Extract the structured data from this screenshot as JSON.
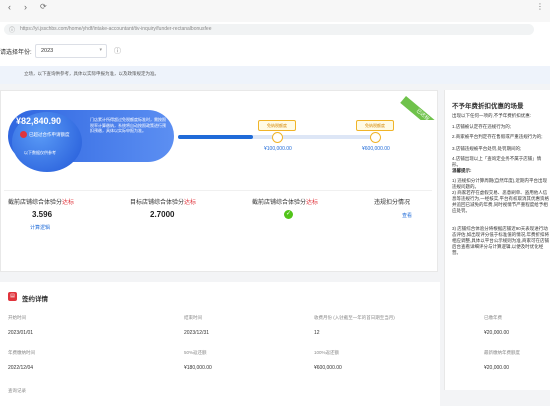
{
  "browser": {
    "url": "https://yi.jsschbs.com/home/yhdf/intake-accountant/tiv-inquiry/funder-rectanalbonusfee"
  },
  "filter": {
    "year_label": "请选择年份:",
    "year_value": "2023"
  },
  "notice": {
    "text": "立场，以下查询供参考，具体以实际申报为准，以及政策规定为准。"
  },
  "summary": {
    "amount": "¥82,840.90",
    "amount_sub": "已超过合作申请额度",
    "bubble_text": "已超过合作条件",
    "desc": "门店累计所得超过免税额度标准时，需按照税率计算缴纳，系统将自动按照政策进行预扣预缴，具体以实际申报为准。",
    "small_note": "以下数据仅供参考",
    "threshold_1": "¥100,000.00",
    "threshold_2": "¥600,000.00",
    "chip_1": "免纳税额度",
    "chip_2": "免纳税额度",
    "ribbon": "已达标"
  },
  "metrics": [
    {
      "title_a": "截前店铺综合体验分",
      "title_b": "达标",
      "value": "3.596",
      "link": "计算逻辑"
    },
    {
      "title_a": "目标店铺综合体验分",
      "title_b": "达标",
      "value": "2.7000",
      "link": ""
    },
    {
      "title_a": "截前店铺综合体验分",
      "title_b": "达标",
      "value": "",
      "link": ""
    },
    {
      "title_a": "违规扣分情况",
      "title_b": "",
      "value": "",
      "link": "查看"
    }
  ],
  "right_panel": {
    "title": "不予年费折扣优惠的场景",
    "lines": [
      "出现以下任何一项的,不予年费折扣优惠:",
      "1.店铺被认定存在违规行为的;",
      "2.商家被平台判定存在售假或严重违规行为的;",
      "3.店铺违规被平台处罚,处罚期间的;",
      "4.店铺出现以上「查询定业务不属于店铺」情形。"
    ],
    "note_title": "温馨提示:",
    "notes": [
      "1) 违规扣分计算周期(自然年度),近期内平台出现违规问题的。",
      "2) 商家若存在虚假交易、恶意刷单、盗用他人信息等违规行为,一经核实,平台有权取消其优惠资格并追回已减免的年费,同时视情节严重程度给予相应处罚。",
      "3) 店铺综合体验分将根据店铺近90天表现进行动态评估,如出现评分低于标准值的情况,年费折扣将相应调整,具体以平台公示规则为准,商家可在店铺后台查看详细评分与计算逻辑,以便及时优化经营。"
    ]
  },
  "contract": {
    "title": "签约详情",
    "row1_labels": [
      "开始时间",
      "结束时间",
      "收费月份 (入驻截至一年的首日期至当月)",
      "已缴年费"
    ],
    "row1_values": [
      "2023/01/01",
      "2023/12/31",
      "12",
      "¥20,000.00"
    ],
    "row2_labels": [
      "年费缴纳时间",
      "50%返还额",
      "100%返还额",
      "最新缴纳年费额度"
    ],
    "row2_values": [
      "2022/12/04",
      "¥180,000.00",
      "¥600,000.00",
      "¥20,000.00"
    ],
    "footer": "查询记录"
  }
}
